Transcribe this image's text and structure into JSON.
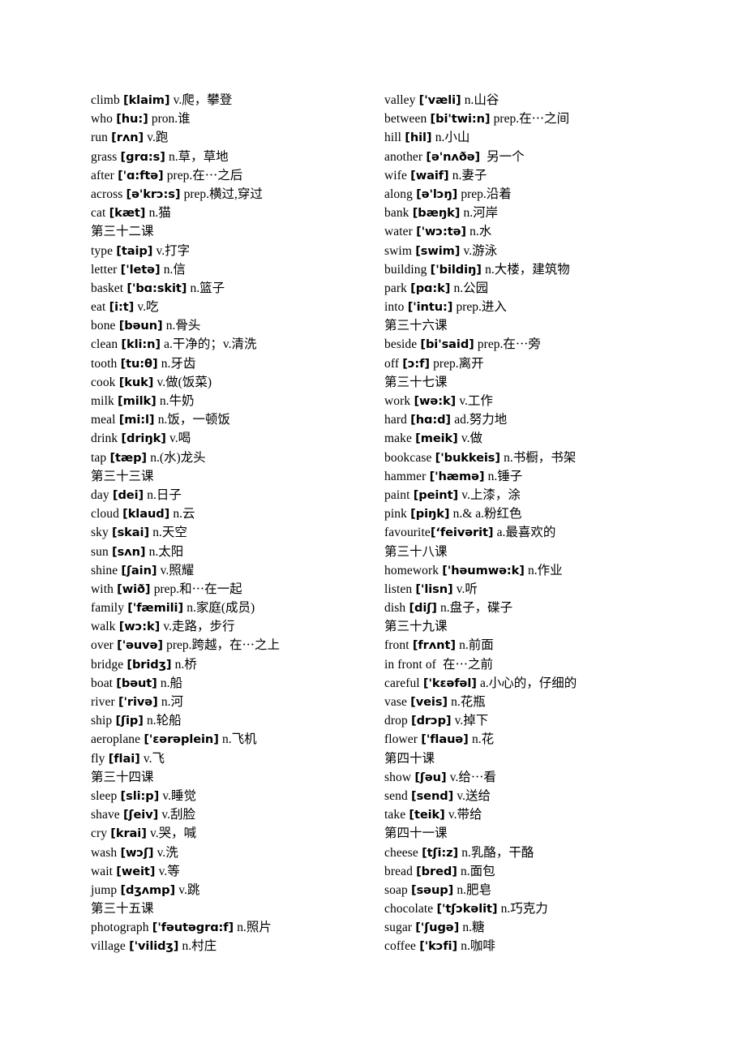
{
  "document": {
    "title": "English-Chinese Vocabulary List (Lessons 32-41)",
    "background_color": "#ffffff",
    "text_color": "#000000",
    "columns": 2
  },
  "columns": [
    {
      "name": "left-column",
      "entries": [
        {
          "type": "word",
          "word": "climb",
          "phonetic": "[klaim]",
          "gloss": "v.爬，攀登"
        },
        {
          "type": "word",
          "word": "who",
          "phonetic": "[hu:]",
          "gloss": "pron.谁"
        },
        {
          "type": "word",
          "word": "run",
          "phonetic": "[rʌn]",
          "gloss": "v.跑"
        },
        {
          "type": "word",
          "word": "grass",
          "phonetic": "[grɑ:s]",
          "gloss": "n.草，草地"
        },
        {
          "type": "word",
          "word": "after",
          "phonetic": "['ɑ:ftə]",
          "gloss": "prep.在⋯之后"
        },
        {
          "type": "word",
          "word": "across",
          "phonetic": "[ə'krɔ:s]",
          "gloss": "prep.横过,穿过"
        },
        {
          "type": "word",
          "word": "cat",
          "phonetic": "[kæt]",
          "gloss": "n.猫"
        },
        {
          "type": "lesson",
          "text": "第三十二课"
        },
        {
          "type": "word",
          "word": "type",
          "phonetic": "[taip]",
          "gloss": "v.打字"
        },
        {
          "type": "word",
          "word": "letter",
          "phonetic": "['letə]",
          "gloss": "n.信"
        },
        {
          "type": "word",
          "word": "basket",
          "phonetic": "['bɑ:skit]",
          "gloss": "n.篮子"
        },
        {
          "type": "word",
          "word": "eat",
          "phonetic": "[i:t]",
          "gloss": "v.吃"
        },
        {
          "type": "word",
          "word": "bone",
          "phonetic": "[bəun]",
          "gloss": "n.骨头"
        },
        {
          "type": "word",
          "word": "clean",
          "phonetic": "[kli:n]",
          "gloss": "a.干净的；v.清洗"
        },
        {
          "type": "word",
          "word": "tooth",
          "phonetic": "[tu:θ]",
          "gloss": "n.牙齿"
        },
        {
          "type": "word",
          "word": "cook",
          "phonetic": "[kuk]",
          "gloss": "v.做(饭菜)"
        },
        {
          "type": "word",
          "word": "milk",
          "phonetic": "[milk]",
          "gloss": "n.牛奶"
        },
        {
          "type": "word",
          "word": "meal",
          "phonetic": "[mi:l]",
          "gloss": "n.饭，一顿饭"
        },
        {
          "type": "word",
          "word": "drink",
          "phonetic": "[driŋk]",
          "gloss": "v.喝"
        },
        {
          "type": "word",
          "word": "tap",
          "phonetic": "[tæp]",
          "gloss": "n.(水)龙头"
        },
        {
          "type": "lesson",
          "text": "第三十三课"
        },
        {
          "type": "word",
          "word": "day",
          "phonetic": "[dei]",
          "gloss": "n.日子"
        },
        {
          "type": "word",
          "word": "cloud",
          "phonetic": "[klaud]",
          "gloss": "n.云"
        },
        {
          "type": "word",
          "word": "sky",
          "phonetic": "[skai]",
          "gloss": "n.天空"
        },
        {
          "type": "word",
          "word": "sun",
          "phonetic": "[sʌn]",
          "gloss": "n.太阳"
        },
        {
          "type": "word",
          "word": "shine",
          "phonetic": "[ʃain]",
          "gloss": "v.照耀"
        },
        {
          "type": "word",
          "word": "with",
          "phonetic": "[wið]",
          "gloss": "prep.和⋯在一起"
        },
        {
          "type": "word",
          "word": "family",
          "phonetic": "['fæmili]",
          "gloss": "n.家庭(成员)"
        },
        {
          "type": "word",
          "word": "walk",
          "phonetic": "[wɔ:k]",
          "gloss": "v.走路，步行"
        },
        {
          "type": "word",
          "word": "over",
          "phonetic": "['əuvə]",
          "gloss": "prep.跨越，在⋯之上"
        },
        {
          "type": "word",
          "word": "bridge",
          "phonetic": "[bridʒ]",
          "gloss": "n.桥"
        },
        {
          "type": "word",
          "word": "boat",
          "phonetic": "[bəut]",
          "gloss": "n.船"
        },
        {
          "type": "word",
          "word": "river",
          "phonetic": "['rivə]",
          "gloss": "n.河"
        },
        {
          "type": "word",
          "word": "ship",
          "phonetic": "[ʃip]",
          "gloss": "n.轮船"
        },
        {
          "type": "word",
          "word": "aeroplane",
          "phonetic": "['ɛərəplein]",
          "gloss": "n.飞机"
        },
        {
          "type": "word",
          "word": "fly",
          "phonetic": "[flai]",
          "gloss": "v.飞"
        },
        {
          "type": "lesson",
          "text": "第三十四课"
        },
        {
          "type": "word",
          "word": "sleep",
          "phonetic": "[sli:p]",
          "gloss": "v.睡觉"
        },
        {
          "type": "word",
          "word": "shave",
          "phonetic": "[ʃeiv]",
          "gloss": "v.刮脸"
        },
        {
          "type": "word",
          "word": "cry",
          "phonetic": "[krai]",
          "gloss": "v.哭，喊"
        },
        {
          "type": "word",
          "word": "wash",
          "phonetic": "[wɔʃ]",
          "gloss": "v.洗"
        },
        {
          "type": "word",
          "word": "wait",
          "phonetic": "[weit]",
          "gloss": "v.等"
        },
        {
          "type": "word",
          "word": "jump",
          "phonetic": "[dʒʌmp]",
          "gloss": "v.跳"
        },
        {
          "type": "lesson",
          "text": "第三十五课"
        },
        {
          "type": "word",
          "word": "photograph",
          "phonetic": "['fəutəgrɑ:f]",
          "gloss": "n.照片"
        },
        {
          "type": "word",
          "word": "village",
          "phonetic": "['vilidʒ]",
          "gloss": "n.村庄"
        }
      ]
    },
    {
      "name": "right-column",
      "entries": [
        {
          "type": "word",
          "word": "valley",
          "phonetic": "['væli]",
          "gloss": "n.山谷"
        },
        {
          "type": "word",
          "word": "between",
          "phonetic": "[bi'twi:n]",
          "gloss": "prep.在⋯之间"
        },
        {
          "type": "word",
          "word": "hill",
          "phonetic": "[hil]",
          "gloss": "n.小山"
        },
        {
          "type": "word",
          "word": "another",
          "phonetic": "[ə'nʌðə]",
          "gloss": "另一个",
          "extra_space": true
        },
        {
          "type": "word",
          "word": "wife",
          "phonetic": "[waif]",
          "gloss": "n.妻子"
        },
        {
          "type": "word",
          "word": "along",
          "phonetic": "[ə'lɔŋ]",
          "gloss": "prep.沿着"
        },
        {
          "type": "word",
          "word": "bank",
          "phonetic": "[bæŋk]",
          "gloss": "n.河岸"
        },
        {
          "type": "word",
          "word": "water",
          "phonetic": "['wɔ:tə]",
          "gloss": "n.水"
        },
        {
          "type": "word",
          "word": "swim",
          "phonetic": "[swim]",
          "gloss": "v.游泳"
        },
        {
          "type": "word",
          "word": "building",
          "phonetic": "['bildiŋ]",
          "gloss": "n.大楼，建筑物"
        },
        {
          "type": "word",
          "word": "park",
          "phonetic": "[pɑ:k]",
          "gloss": "n.公园"
        },
        {
          "type": "word",
          "word": "into",
          "phonetic": "['intu:]",
          "gloss": "prep.进入"
        },
        {
          "type": "lesson",
          "text": "第三十六课"
        },
        {
          "type": "word",
          "word": "beside",
          "phonetic": "[bi'said]",
          "gloss": "prep.在⋯旁"
        },
        {
          "type": "word",
          "word": "off",
          "phonetic": "[ɔ:f]",
          "gloss": "prep.离开"
        },
        {
          "type": "lesson",
          "text": "第三十七课"
        },
        {
          "type": "word",
          "word": "work",
          "phonetic": "[wə:k]",
          "gloss": "v.工作"
        },
        {
          "type": "word",
          "word": "hard",
          "phonetic": "[hɑ:d]",
          "gloss": "ad.努力地"
        },
        {
          "type": "word",
          "word": "make",
          "phonetic": "[meik]",
          "gloss": "v.做"
        },
        {
          "type": "word",
          "word": "bookcase",
          "phonetic": "['bukkeis]",
          "gloss": "n.书橱，书架"
        },
        {
          "type": "word",
          "word": "hammer",
          "phonetic": "['hæmə]",
          "gloss": "n.锤子"
        },
        {
          "type": "word",
          "word": "paint",
          "phonetic": "[peint]",
          "gloss": "v.上漆，涂"
        },
        {
          "type": "word",
          "word": "pink",
          "phonetic": "[piŋk]",
          "gloss": "n.& a.粉红色"
        },
        {
          "type": "word",
          "word": "favourite",
          "phonetic": "[‘feivərit]",
          "gloss": "a.最喜欢的",
          "no_gap": true
        },
        {
          "type": "lesson",
          "text": "第三十八课"
        },
        {
          "type": "word",
          "word": "homework",
          "phonetic": "['həumwə:k]",
          "gloss": "n.作业"
        },
        {
          "type": "word",
          "word": "listen",
          "phonetic": "['lisn]",
          "gloss": "v.听"
        },
        {
          "type": "word",
          "word": "dish",
          "phonetic": "[diʃ]",
          "gloss": "n.盘子，碟子"
        },
        {
          "type": "lesson",
          "text": "第三十九课"
        },
        {
          "type": "word",
          "word": "front",
          "phonetic": "[frʌnt]",
          "gloss": "n.前面"
        },
        {
          "type": "phrase",
          "word": "in front of",
          "phonetic": "",
          "gloss": "在⋯之前"
        },
        {
          "type": "word",
          "word": "careful",
          "phonetic": "['kɛəfəl]",
          "gloss": "a.小心的，仔细的"
        },
        {
          "type": "word",
          "word": "vase",
          "phonetic": "[veis]",
          "gloss": "n.花瓶"
        },
        {
          "type": "word",
          "word": "drop",
          "phonetic": "[drɔp]",
          "gloss": "v.掉下"
        },
        {
          "type": "word",
          "word": "flower",
          "phonetic": "['flauə]",
          "gloss": "n.花"
        },
        {
          "type": "lesson",
          "text": "第四十课"
        },
        {
          "type": "word",
          "word": "show",
          "phonetic": "[ʃəu]",
          "gloss": "v.给⋯看"
        },
        {
          "type": "word",
          "word": "send",
          "phonetic": "[send]",
          "gloss": "v.送给"
        },
        {
          "type": "word",
          "word": "take",
          "phonetic": "[teik]",
          "gloss": "v.带给"
        },
        {
          "type": "lesson",
          "text": "第四十一课"
        },
        {
          "type": "word",
          "word": "cheese",
          "phonetic": "[tʃi:z]",
          "gloss": "n.乳酪，干酪"
        },
        {
          "type": "word",
          "word": "bread",
          "phonetic": "[bred]",
          "gloss": "n.面包"
        },
        {
          "type": "word",
          "word": "soap",
          "phonetic": "[səup]",
          "gloss": "n.肥皂"
        },
        {
          "type": "word",
          "word": "chocolate",
          "phonetic": "['tʃɔkəlit]",
          "gloss": "n.巧克力"
        },
        {
          "type": "word",
          "word": "sugar",
          "phonetic": "['ʃugə]",
          "gloss": "n.糖"
        },
        {
          "type": "word",
          "word": "coffee",
          "phonetic": "['kɔfi]",
          "gloss": "n.咖啡"
        }
      ]
    }
  ]
}
